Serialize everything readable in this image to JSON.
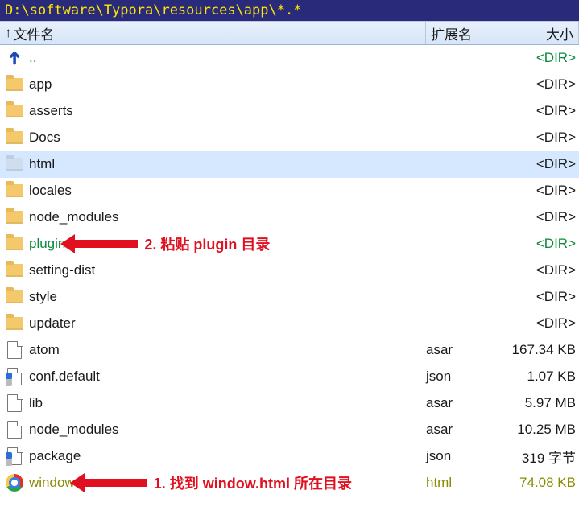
{
  "path": "D:\\software\\Typora\\resources\\app\\*.*",
  "columns": {
    "name": "文件名",
    "ext": "扩展名",
    "size": "大小"
  },
  "dir_label": "<DIR>",
  "up_label": "..",
  "annotations": {
    "plugin": "2. 粘贴 plugin 目录",
    "window": "1. 找到 window.html 所在目录"
  },
  "rows": [
    {
      "type": "up",
      "name": "..",
      "ext": "",
      "size": "<DIR>",
      "green": true
    },
    {
      "type": "dir",
      "name": "app",
      "ext": "",
      "size": "<DIR>"
    },
    {
      "type": "dir",
      "name": "asserts",
      "ext": "",
      "size": "<DIR>"
    },
    {
      "type": "dir",
      "name": "Docs",
      "ext": "",
      "size": "<DIR>"
    },
    {
      "type": "dir",
      "name": "html",
      "ext": "",
      "size": "<DIR>",
      "selected": true
    },
    {
      "type": "dir",
      "name": "locales",
      "ext": "",
      "size": "<DIR>"
    },
    {
      "type": "dir",
      "name": "node_modules",
      "ext": "",
      "size": "<DIR>"
    },
    {
      "type": "dir",
      "name": "plugin",
      "ext": "",
      "size": "<DIR>",
      "green": true,
      "annot": "plugin"
    },
    {
      "type": "dir",
      "name": "setting-dist",
      "ext": "",
      "size": "<DIR>"
    },
    {
      "type": "dir",
      "name": "style",
      "ext": "",
      "size": "<DIR>"
    },
    {
      "type": "dir",
      "name": "updater",
      "ext": "",
      "size": "<DIR>"
    },
    {
      "type": "file",
      "icon": "file",
      "name": "atom",
      "ext": "asar",
      "size": "167.34 KB"
    },
    {
      "type": "file",
      "icon": "json",
      "name": "conf.default",
      "ext": "json",
      "size": "1.07 KB"
    },
    {
      "type": "file",
      "icon": "file",
      "name": "lib",
      "ext": "asar",
      "size": "5.97 MB"
    },
    {
      "type": "file",
      "icon": "file",
      "name": "node_modules",
      "ext": "asar",
      "size": "10.25 MB"
    },
    {
      "type": "file",
      "icon": "json",
      "name": "package",
      "ext": "json",
      "size": "319 字节"
    },
    {
      "type": "file",
      "icon": "html",
      "name": "window",
      "ext": "html",
      "size": "74.08 KB",
      "highlight": true,
      "annot": "window"
    }
  ]
}
